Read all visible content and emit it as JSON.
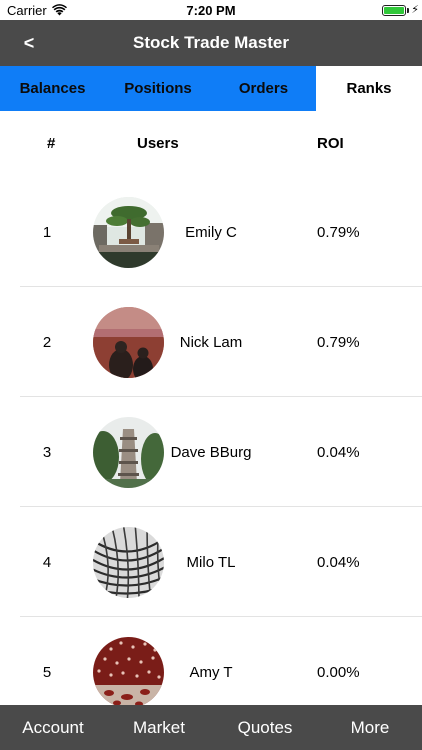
{
  "status_bar": {
    "carrier": "Carrier",
    "time": "7:20 PM",
    "battery_color": "#31c83a"
  },
  "navbar": {
    "back_label": "<",
    "title": "Stock Trade Master",
    "background": "#4a4a4a"
  },
  "tabs": [
    {
      "label": "Balances",
      "active": false
    },
    {
      "label": "Positions",
      "active": false
    },
    {
      "label": "Orders",
      "active": false
    },
    {
      "label": "Ranks",
      "active": true
    }
  ],
  "tab_accent_color": "#0f7df7",
  "table": {
    "headers": {
      "rank": "#",
      "users": "Users",
      "roi": "ROI"
    },
    "rows": [
      {
        "rank": "1",
        "name": "Emily C",
        "roi": "0.79%",
        "avatar": "bonsai-garden-photo"
      },
      {
        "rank": "2",
        "name": "Nick Lam",
        "roi": "0.79%",
        "avatar": "sunset-couple-photo"
      },
      {
        "rank": "3",
        "name": "Dave BBurg",
        "roi": "0.04%",
        "avatar": "pagoda-tower-photo"
      },
      {
        "rank": "4",
        "name": "Milo TL",
        "roi": "0.04%",
        "avatar": "lattice-architecture-photo"
      },
      {
        "rank": "5",
        "name": "Amy T",
        "roi": "0.00%",
        "avatar": "red-dotted-room-photo"
      }
    ]
  },
  "bottom_tabs": [
    {
      "label": "Account"
    },
    {
      "label": "Market"
    },
    {
      "label": "Quotes"
    },
    {
      "label": "More"
    }
  ]
}
